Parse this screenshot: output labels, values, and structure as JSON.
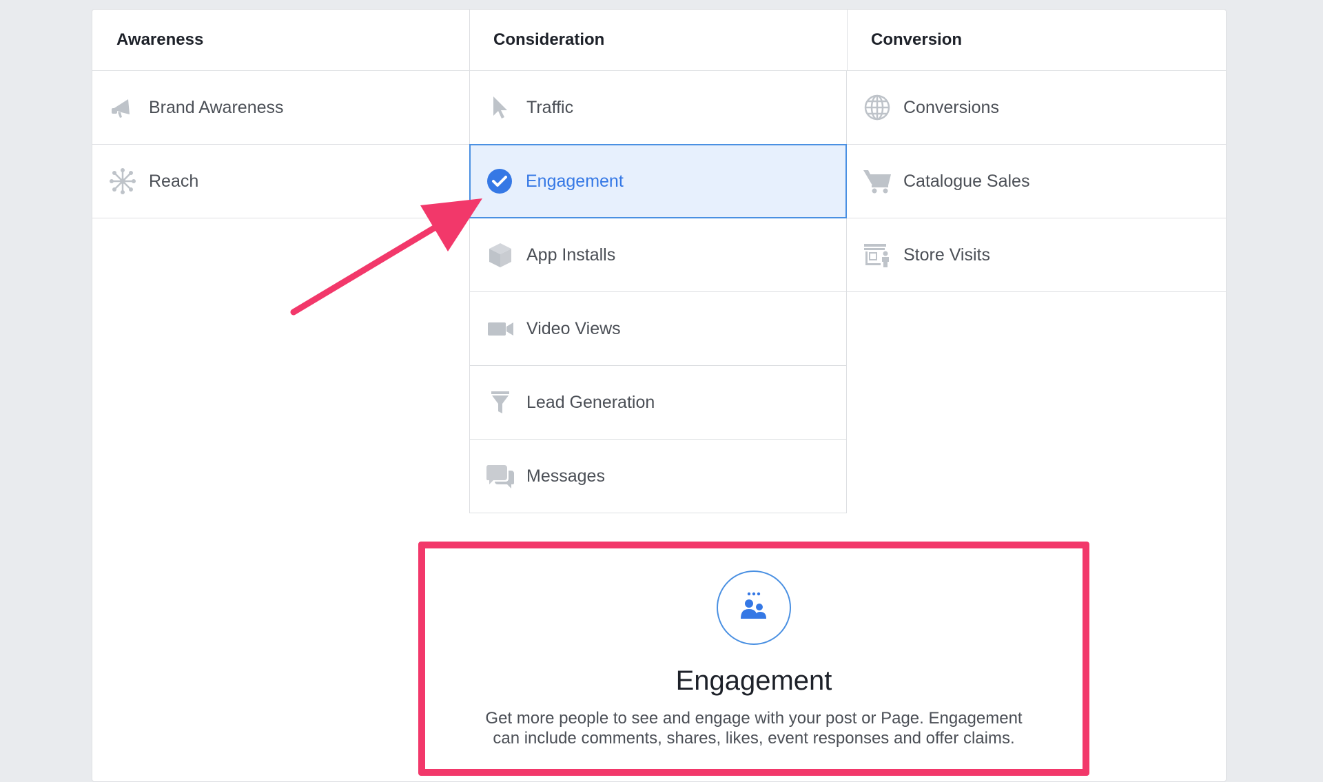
{
  "columns": {
    "awareness": {
      "title": "Awareness",
      "items": [
        {
          "label": "Brand Awareness",
          "icon": "megaphone-icon"
        },
        {
          "label": "Reach",
          "icon": "reach-icon"
        }
      ]
    },
    "consideration": {
      "title": "Consideration",
      "items": [
        {
          "label": "Traffic",
          "icon": "cursor-icon"
        },
        {
          "label": "Engagement",
          "icon": "check-circle-icon",
          "selected": true
        },
        {
          "label": "App Installs",
          "icon": "box-icon"
        },
        {
          "label": "Video Views",
          "icon": "video-camera-icon"
        },
        {
          "label": "Lead Generation",
          "icon": "funnel-icon"
        },
        {
          "label": "Messages",
          "icon": "chat-bubbles-icon"
        }
      ]
    },
    "conversion": {
      "title": "Conversion",
      "items": [
        {
          "label": "Conversions",
          "icon": "globe-icon"
        },
        {
          "label": "Catalogue Sales",
          "icon": "shopping-cart-icon"
        },
        {
          "label": "Store Visits",
          "icon": "store-icon"
        }
      ]
    }
  },
  "detail": {
    "title": "Engagement",
    "description_line1": "Get more people to see and engage with your post or Page. Engagement",
    "description_line2": "can include comments, shares, likes, event responses and offer claims.",
    "icon": "people-group-icon"
  },
  "colors": {
    "accent": "#3578e5",
    "selected_bg": "#e7f0fd",
    "highlight": "#f2386a",
    "icon_gray": "#bec3c9"
  }
}
